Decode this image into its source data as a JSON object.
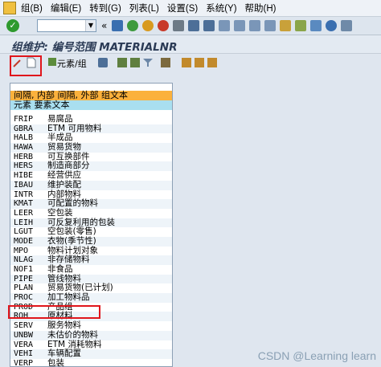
{
  "menubar": {
    "items": [
      "组(B)",
      "编辑(E)",
      "转到(G)",
      "列表(L)",
      "设置(S)",
      "系统(Y)",
      "帮助(H)"
    ]
  },
  "toolbar": {
    "command_placeholder": "",
    "nav_glyph": "«"
  },
  "title": "组维护: 编号范围 MATERIALNR",
  "toolbar2": {
    "element_group_label": "元素/组"
  },
  "list": {
    "header_group": "间隔, 内部 间隔, 外部 组文本",
    "header_element": "元素 要素文本",
    "rows": [
      {
        "code": "FRIP",
        "text": "易腐品"
      },
      {
        "code": "GBRA",
        "text": "ETM 可用物料"
      },
      {
        "code": "HALB",
        "text": "半成品"
      },
      {
        "code": "HAWA",
        "text": "贸易货物"
      },
      {
        "code": "HERB",
        "text": "可互换部件"
      },
      {
        "code": "HERS",
        "text": "制造商部分"
      },
      {
        "code": "HIBE",
        "text": "经营供应"
      },
      {
        "code": "IBAU",
        "text": "维护装配"
      },
      {
        "code": "INTR",
        "text": "内部物料"
      },
      {
        "code": "KMAT",
        "text": "可配置的物料"
      },
      {
        "code": "LEER",
        "text": "空包装"
      },
      {
        "code": "LEIH",
        "text": "可反复利用的包装"
      },
      {
        "code": "LGUT",
        "text": "空包装(零售)"
      },
      {
        "code": "MODE",
        "text": "衣物(季节性)"
      },
      {
        "code": "MPO",
        "text": "物料计划对象"
      },
      {
        "code": "NLAG",
        "text": "非存储物料"
      },
      {
        "code": "NOF1",
        "text": "非食品"
      },
      {
        "code": "PIPE",
        "text": "管线物料"
      },
      {
        "code": "PLAN",
        "text": "贸易货物(已计划)"
      },
      {
        "code": "PROC",
        "text": "加工物料品"
      },
      {
        "code": "PROD",
        "text": "产品组"
      },
      {
        "code": "ROH",
        "text": "原材料"
      },
      {
        "code": "SERV",
        "text": "服务物料"
      },
      {
        "code": "UNBW",
        "text": "未估价的物料"
      },
      {
        "code": "VERA",
        "text": "ETM 消耗物料"
      },
      {
        "code": "VEHI",
        "text": "车辆配置"
      },
      {
        "code": "VERP",
        "text": "包装"
      }
    ]
  },
  "watermark": "CSDN @Learning learn"
}
